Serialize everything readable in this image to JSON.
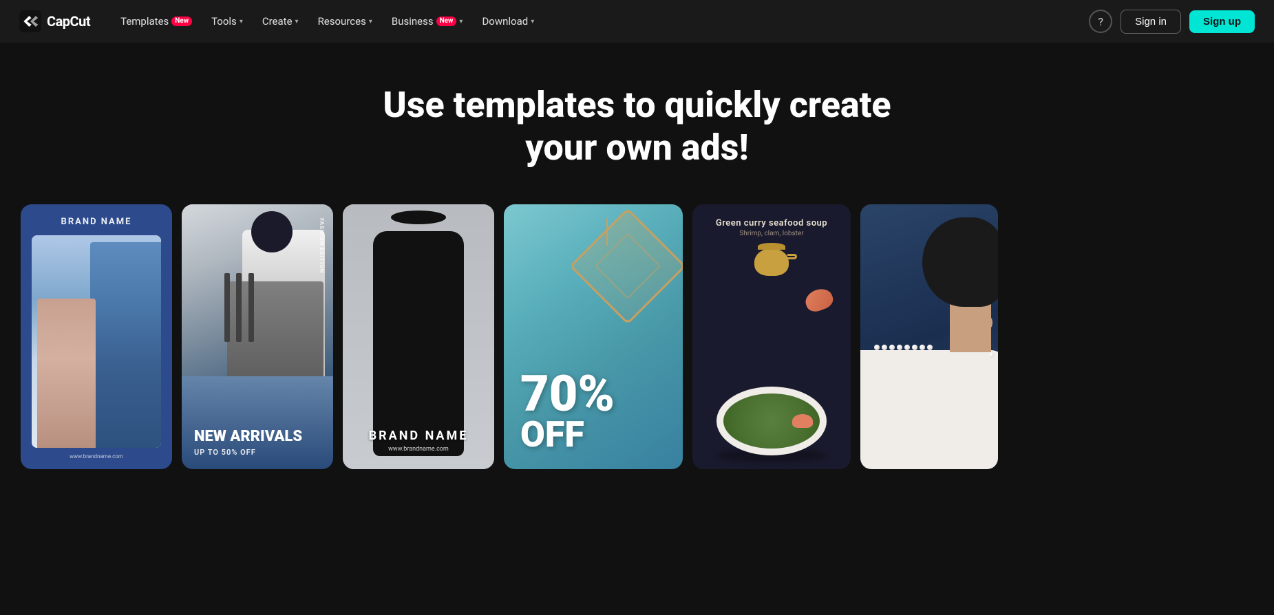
{
  "logo": {
    "text": "CapCut"
  },
  "nav": {
    "items": [
      {
        "label": "Templates",
        "badge": "New",
        "has_dropdown": false
      },
      {
        "label": "Tools",
        "has_dropdown": true
      },
      {
        "label": "Create",
        "has_dropdown": true
      },
      {
        "label": "Resources",
        "has_dropdown": true
      },
      {
        "label": "Business",
        "badge": "New",
        "has_dropdown": true
      },
      {
        "label": "Download",
        "has_dropdown": true
      }
    ],
    "help_label": "?",
    "signin_label": "Sign in",
    "signup_label": "Sign up"
  },
  "hero": {
    "title": "Use templates to quickly create your own ads!"
  },
  "cards": [
    {
      "id": "card-1",
      "type": "brand-blue",
      "brand_name": "BRAND NAME",
      "url": "www.brandname.com"
    },
    {
      "id": "card-2",
      "type": "fashion-arrivals",
      "title": "NEW ARRIVALS",
      "subtitle": "UP TO 50% OFF",
      "badge_text": "FASHION EDITION"
    },
    {
      "id": "card-3",
      "type": "brand-black",
      "brand_name": "BRAND NAME",
      "url": "www.brandname.com"
    },
    {
      "id": "card-4",
      "type": "sale",
      "sale_number": "70%",
      "sale_text": "OFF"
    },
    {
      "id": "card-5",
      "type": "food",
      "title": "Green curry seafood soup",
      "subtitle": "Shrimp, clam, lobster"
    },
    {
      "id": "card-6",
      "type": "portrait",
      "description": "Woman with pearl necklace on blue background"
    }
  ],
  "colors": {
    "nav_bg": "#1a1a1a",
    "page_bg": "#111111",
    "badge_red": "#ff0044",
    "accent_cyan": "#00e5d4",
    "card1_bg": "#2c4a8c",
    "card4_bg": "#5ab0bc",
    "card5_bg": "#1a1a2e",
    "card6_bg": "#2a4060"
  }
}
